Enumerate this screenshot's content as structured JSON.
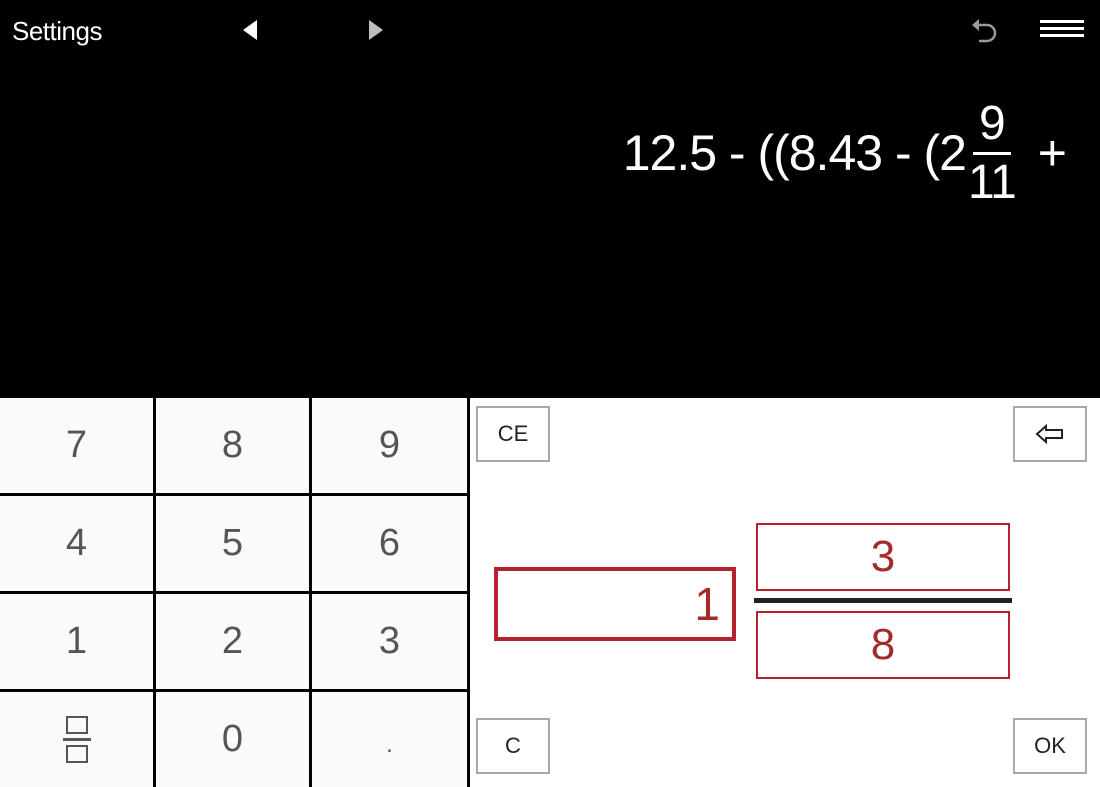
{
  "header": {
    "settings_label": "Settings"
  },
  "display": {
    "expression_prefix": "12.5 - ((8.43 - (2",
    "fraction_numerator": "9",
    "fraction_denominator": "11",
    "expression_suffix": "+"
  },
  "keypad": {
    "keys": [
      "7",
      "8",
      "9",
      "4",
      "5",
      "6",
      "1",
      "2",
      "3",
      "0",
      "."
    ]
  },
  "controls": {
    "ce_label": "CE",
    "c_label": "C",
    "ok_label": "OK"
  },
  "entry": {
    "whole": "1",
    "numerator": "3",
    "denominator": "8"
  },
  "colors": {
    "accent": "#b5222b",
    "background": "#000000",
    "key_bg": "#fafafa"
  }
}
